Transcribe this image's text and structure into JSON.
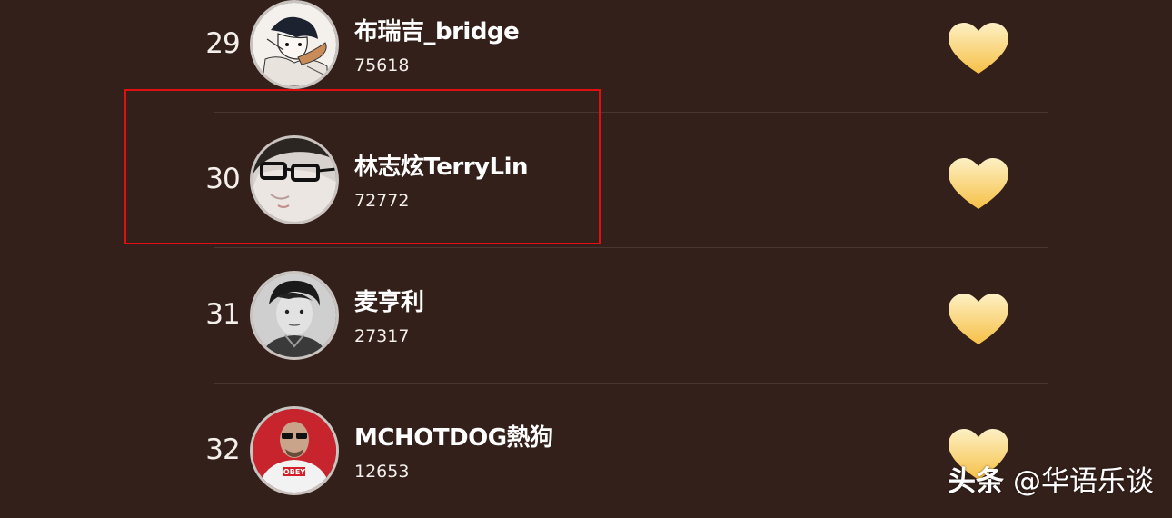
{
  "rankings": [
    {
      "rank": "29",
      "name": "布瑞吉_bridge",
      "count": "75618",
      "avatar": "avatar-anime-sketch"
    },
    {
      "rank": "30",
      "name": "林志炫TerryLin",
      "count": "72772",
      "avatar": "avatar-glasses-face"
    },
    {
      "rank": "31",
      "name": "麦亨利",
      "count": "27317",
      "avatar": "avatar-bw-portrait"
    },
    {
      "rank": "32",
      "name": "MCHOTDOG熱狗",
      "count": "12653",
      "avatar": "avatar-red-obey"
    }
  ],
  "colors": {
    "background": "#34201a",
    "highlight_border": "#e01010",
    "heart_top": "#fdf0c4",
    "heart_bottom": "#f6c046"
  },
  "icons": {
    "heart": "heart-icon"
  },
  "watermark": {
    "brand": "头条",
    "handle": "@华语乐谈"
  }
}
